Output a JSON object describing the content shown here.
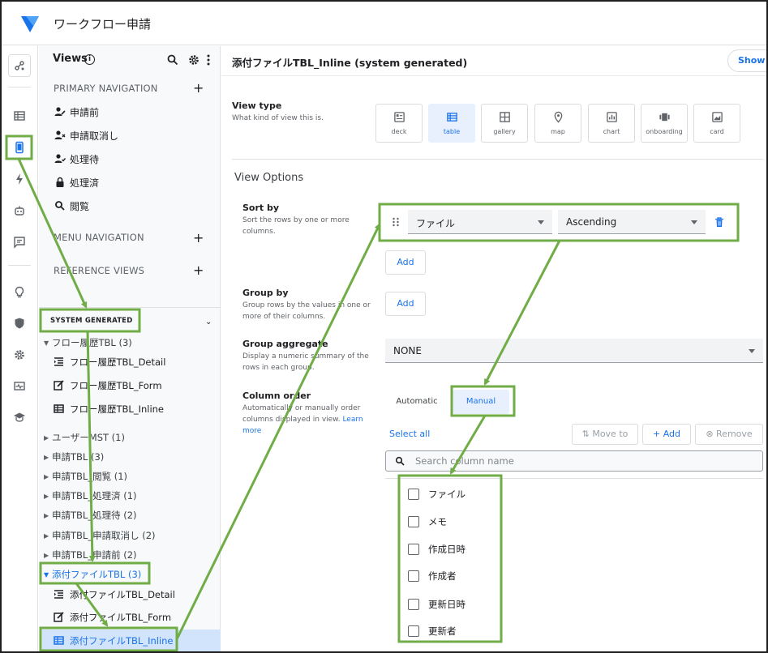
{
  "app": {
    "title": "ワークフロー申請"
  },
  "views_panel": {
    "title": "Views",
    "primary_navigation": {
      "heading": "PRIMARY NAVIGATION",
      "items": [
        {
          "label": "申請前",
          "icon": "person-edit-icon"
        },
        {
          "label": "申請取消し",
          "icon": "person-remove-icon"
        },
        {
          "label": "処理待",
          "icon": "person-check-icon"
        },
        {
          "label": "処理済",
          "icon": "lock-icon"
        },
        {
          "label": "閲覧",
          "icon": "search-icon"
        }
      ]
    },
    "menu_navigation": {
      "heading": "MENU NAVIGATION"
    },
    "reference_views": {
      "heading": "REFERENCE VIEWS"
    },
    "system_generated": {
      "heading": "SYSTEM GENERATED",
      "groups": [
        {
          "label": "フロー履歴TBL (3)",
          "expanded": true,
          "children": [
            "フロー履歴TBL_Detail",
            "フロー履歴TBL_Form",
            "フロー履歴TBL_Inline"
          ]
        },
        {
          "label": "ユーザーMST (1)"
        },
        {
          "label": "申請TBL (3)"
        },
        {
          "label": "申請TBL_閲覧 (1)"
        },
        {
          "label": "申請TBL_処理済 (1)"
        },
        {
          "label": "申請TBL_処理待 (2)"
        },
        {
          "label": "申請TBL_申請取消し (2)"
        },
        {
          "label": "申請TBL_申請前 (2)"
        },
        {
          "label": "添付ファイルTBL (3)",
          "expanded": true,
          "children": [
            "添付ファイルTBL_Detail",
            "添付ファイルTBL_Form",
            "添付ファイルTBL_Inline"
          ]
        }
      ]
    }
  },
  "main": {
    "view_title": "添付ファイルTBL_Inline (system generated)",
    "show_button": "Show i",
    "view_type": {
      "label": "View type",
      "description": "What kind of view this is.",
      "options": [
        "deck",
        "table",
        "gallery",
        "map",
        "chart",
        "onboarding",
        "card"
      ],
      "selected": "table"
    },
    "view_options_title": "View Options",
    "sort_by": {
      "label": "Sort by",
      "description": "Sort the rows by one or more columns.",
      "column": "ファイル",
      "direction": "Ascending",
      "add_label": "Add"
    },
    "group_by": {
      "label": "Group by",
      "description": "Group rows by the values in one or more of their columns.",
      "add_label": "Add"
    },
    "group_aggregate": {
      "label": "Group aggregate",
      "description": "Display a numeric summary of the rows in each group.",
      "value": "NONE"
    },
    "column_order": {
      "label": "Column order",
      "description": "Automatically or manually order columns displayed in view.",
      "learn_more": "Learn more",
      "automatic_label": "Automatic",
      "manual_label": "Manual",
      "selected": "Manual",
      "select_all": "Select all",
      "move_to": "Move to",
      "add": "+ Add",
      "remove": "Remove",
      "search_placeholder": "Search column name",
      "columns": [
        "ファイル",
        "メモ",
        "作成日時",
        "作成者",
        "更新日時",
        "更新者"
      ]
    }
  },
  "colors": {
    "accent": "#1a73e8",
    "selected_bg": "#d2e3fc",
    "annotation_green": "#70ad47"
  }
}
